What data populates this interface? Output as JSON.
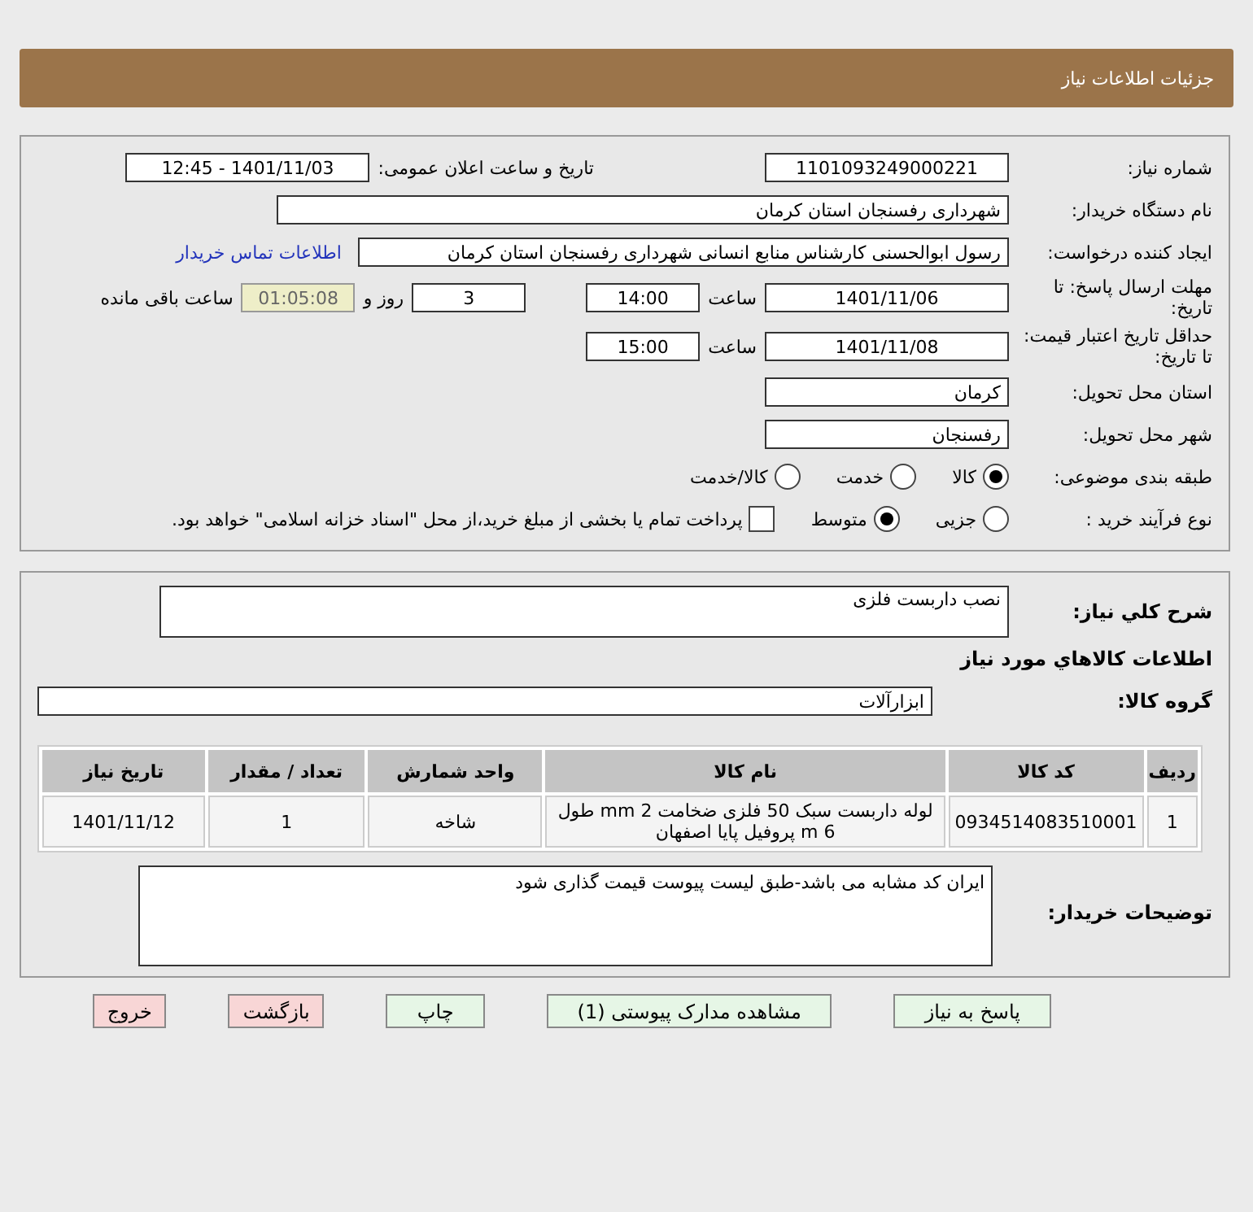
{
  "title": "جزئیات اطلاعات نیاز",
  "need_number": {
    "label": "شماره نیاز:",
    "value": "1101093249000221"
  },
  "announce": {
    "label": "تاریخ و ساعت اعلان عمومی:",
    "value": "1401/11/03 - 12:45"
  },
  "buyer": {
    "label": "نام دستگاه خریدار:",
    "value": "شهرداری رفسنجان استان کرمان"
  },
  "creator": {
    "label": "ایجاد کننده درخواست:",
    "value": "رسول ابوالحسنی کارشناس منابع انسانی شهرداری رفسنجان استان کرمان",
    "link": "اطلاعات تماس خریدار"
  },
  "deadline": {
    "label": "مهلت ارسال پاسخ: تا تاریخ:",
    "date": "1401/11/06",
    "time_label": "ساعت",
    "time": "14:00",
    "days": "3",
    "days_label": "روز و",
    "remaining": "01:05:08",
    "remaining_label": "ساعت باقی مانده"
  },
  "validity": {
    "label": "حداقل تاریخ اعتبار قیمت: تا تاریخ:",
    "date": "1401/11/08",
    "time_label": "ساعت",
    "time": "15:00"
  },
  "province": {
    "label": "استان محل تحویل:",
    "value": "کرمان"
  },
  "city": {
    "label": "شهر محل تحویل:",
    "value": "رفسنجان"
  },
  "category": {
    "label": "طبقه بندی موضوعی:",
    "options": [
      {
        "label": "کالا",
        "selected": true
      },
      {
        "label": "خدمت",
        "selected": false
      },
      {
        "label": "کالا/خدمت",
        "selected": false
      }
    ]
  },
  "process": {
    "label": "نوع فرآیند خرید :",
    "options": [
      {
        "label": "جزیی",
        "selected": false
      },
      {
        "label": "متوسط",
        "selected": true
      }
    ],
    "treasury": {
      "checked": false,
      "label": "پرداخت تمام یا بخشی از مبلغ خرید،از محل \"اسناد خزانه اسلامی\" خواهد بود."
    }
  },
  "description": {
    "label": "شرح کلي نياز:",
    "value": "نصب داربست فلزی"
  },
  "goods_heading": "اطلاعات کالاهاي مورد نياز",
  "goods_group": {
    "label": "گروه کالا:",
    "value": "ابزارآلات"
  },
  "table": {
    "columns": [
      "ردیف",
      "کد کالا",
      "نام کالا",
      "واحد شمارش",
      "تعداد / مقدار",
      "تاریخ نیاز"
    ],
    "rows": [
      {
        "cells": [
          "1",
          "0934514083510001",
          "لوله داربست سبک 50 فلزی ضخامت 2 mm طول 6 m پروفیل پایا اصفهان",
          "شاخه",
          "1",
          "1401/11/12"
        ]
      }
    ]
  },
  "buyer_notes": {
    "label": "توضیحات خریدار:",
    "value": "ایران کد مشابه می باشد-طبق لیست پیوست قیمت گذاری شود"
  },
  "buttons": [
    {
      "label": "پاسخ به نیاز",
      "kind": "normal"
    },
    {
      "label": "مشاهده مدارک پیوستی (1)",
      "kind": "normal"
    },
    {
      "label": "چاپ",
      "kind": "normal"
    },
    {
      "label": "بازگشت",
      "kind": "exit"
    },
    {
      "label": "خروج",
      "kind": "exit"
    }
  ]
}
